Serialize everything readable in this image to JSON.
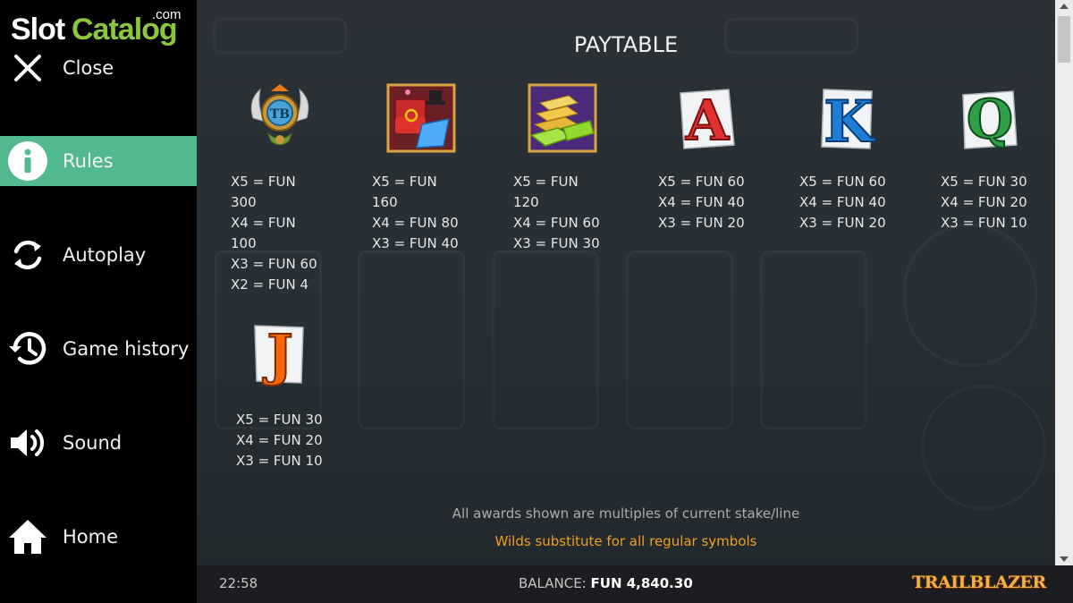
{
  "logo": {
    "slot": "Slot",
    "catalog": "Catalog",
    "com": ".com"
  },
  "nav": [
    {
      "label": "Close",
      "icon": "close-icon"
    },
    {
      "label": "Rules",
      "icon": "info-icon"
    },
    {
      "label": "Autoplay",
      "icon": "autoplay-icon"
    },
    {
      "label": "Game history",
      "icon": "history-icon"
    },
    {
      "label": "Sound",
      "icon": "speaker-icon"
    },
    {
      "label": "Home",
      "icon": "home-icon"
    }
  ],
  "paytable": {
    "title": "PAYTABLE",
    "symbols": [
      {
        "icon": "trailblazer-emblem-icon",
        "lines": [
          "X5 = FUN",
          "300",
          "X4 = FUN",
          "100",
          "X3 = FUN 60",
          "X2 = FUN 4"
        ]
      },
      {
        "icon": "ring-box-icon",
        "lines": [
          "X5 = FUN",
          "160",
          "X4 = FUN 80",
          "X3 = FUN 40"
        ]
      },
      {
        "icon": "gold-cash-icon",
        "lines": [
          "X5 = FUN",
          "120",
          "X4 = FUN 60",
          "X3 = FUN 30"
        ]
      },
      {
        "icon": "letter-a-icon",
        "glyph": "A",
        "lines": [
          "X5 = FUN 60",
          "X4 = FUN 40",
          "X3 = FUN 20"
        ]
      },
      {
        "icon": "letter-k-icon",
        "glyph": "K",
        "lines": [
          "X5 = FUN 60",
          "X4 = FUN 40",
          "X3 = FUN 20"
        ]
      },
      {
        "icon": "letter-q-icon",
        "glyph": "Q",
        "lines": [
          "X5 = FUN 30",
          "X4 = FUN 20",
          "X3 = FUN 10"
        ]
      },
      {
        "icon": "letter-j-icon",
        "glyph": "J",
        "lines": [
          "X5 = FUN 30",
          "X4 = FUN 20",
          "X3 = FUN 10"
        ]
      }
    ],
    "note_multiples": "All awards shown are multiples of current stake/line",
    "note_wilds": "Wilds substitute for all regular symbols"
  },
  "footer": {
    "time": "22:58",
    "balance_label": "BALANCE:",
    "balance_value": "FUN 4,840.30",
    "brand": "TRAILBLAZER"
  },
  "colors": {
    "accent": "#52b98f",
    "note_highlight": "#f0a020",
    "logo_green": "#8cc63f"
  }
}
